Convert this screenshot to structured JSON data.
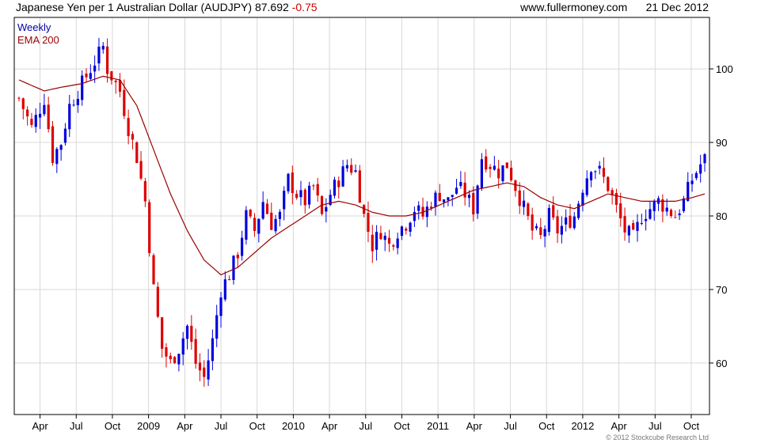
{
  "header": {
    "instrument": "Japanese Yen per 1 Australian Dollar (AUDJPY)",
    "last": "87.692",
    "change": "-0.75",
    "site": "www.fullermoney.com",
    "date": "21 Dec 2012"
  },
  "footer": {
    "copyright": "© 2012 Stockcube Research Ltd"
  },
  "colors": {
    "up": "#0000dd",
    "down": "#dd0000",
    "ema": "#990000",
    "grid": "#d8d8d8",
    "legend_weekly": "#0000aa",
    "legend_ema": "#990000"
  },
  "chart_data": {
    "type": "candlestick",
    "legend": [
      {
        "label": "Weekly"
      },
      {
        "label": "EMA 200"
      }
    ],
    "ylim": [
      53,
      107
    ],
    "y_ticks": [
      60,
      70,
      80,
      90,
      100
    ],
    "grid": true,
    "x_tick_labels": [
      "Apr",
      "Jul",
      "Oct",
      "2009",
      "Apr",
      "Jul",
      "Oct",
      "2010",
      "Apr",
      "Jul",
      "Oct",
      "2011",
      "Apr",
      "Jul",
      "Oct",
      "2012",
      "Apr",
      "Jul",
      "Oct"
    ],
    "price_anchors_weekly_close": [
      [
        0,
        96
      ],
      [
        3,
        92
      ],
      [
        6,
        96
      ],
      [
        8,
        88
      ],
      [
        10,
        90
      ],
      [
        12,
        95
      ],
      [
        15,
        98
      ],
      [
        18,
        101
      ],
      [
        20,
        103
      ],
      [
        21,
        100
      ],
      [
        24,
        97
      ],
      [
        26,
        92
      ],
      [
        28,
        88
      ],
      [
        30,
        82
      ],
      [
        32,
        70
      ],
      [
        34,
        62
      ],
      [
        36,
        60
      ],
      [
        38,
        62
      ],
      [
        40,
        65
      ],
      [
        42,
        60
      ],
      [
        44,
        58
      ],
      [
        46,
        63
      ],
      [
        48,
        70
      ],
      [
        50,
        72
      ],
      [
        52,
        75
      ],
      [
        54,
        80
      ],
      [
        56,
        78
      ],
      [
        58,
        82
      ],
      [
        60,
        79
      ],
      [
        62,
        80
      ],
      [
        64,
        85
      ],
      [
        66,
        83
      ],
      [
        68,
        82
      ],
      [
        70,
        84
      ],
      [
        72,
        80
      ],
      [
        74,
        83
      ],
      [
        76,
        85
      ],
      [
        78,
        87
      ],
      [
        80,
        86
      ],
      [
        82,
        80
      ],
      [
        84,
        76
      ],
      [
        86,
        78
      ],
      [
        88,
        76
      ],
      [
        90,
        78
      ],
      [
        92,
        79
      ],
      [
        94,
        81
      ],
      [
        96,
        80
      ],
      [
        98,
        82
      ],
      [
        100,
        83
      ],
      [
        102,
        82
      ],
      [
        104,
        84
      ],
      [
        106,
        83
      ],
      [
        108,
        81
      ],
      [
        110,
        88
      ],
      [
        112,
        87
      ],
      [
        114,
        86
      ],
      [
        116,
        87
      ],
      [
        118,
        84
      ],
      [
        120,
        81
      ],
      [
        122,
        78
      ],
      [
        124,
        77
      ],
      [
        126,
        80
      ],
      [
        128,
        78
      ],
      [
        130,
        79
      ],
      [
        132,
        80
      ],
      [
        134,
        84
      ],
      [
        136,
        87
      ],
      [
        138,
        86
      ],
      [
        140,
        84
      ],
      [
        142,
        81
      ],
      [
        144,
        78
      ],
      [
        146,
        77
      ],
      [
        148,
        80
      ],
      [
        150,
        81
      ],
      [
        152,
        82
      ],
      [
        154,
        81
      ],
      [
        156,
        80
      ],
      [
        158,
        82
      ],
      [
        160,
        85
      ],
      [
        162,
        87
      ],
      [
        163,
        87.69
      ]
    ],
    "ema200_anchors": [
      [
        0,
        98.5
      ],
      [
        6,
        97
      ],
      [
        10,
        97.5
      ],
      [
        15,
        98
      ],
      [
        20,
        99
      ],
      [
        24,
        98.5
      ],
      [
        28,
        95
      ],
      [
        32,
        89
      ],
      [
        36,
        83
      ],
      [
        40,
        78
      ],
      [
        44,
        74
      ],
      [
        48,
        72
      ],
      [
        52,
        73
      ],
      [
        56,
        75
      ],
      [
        60,
        77
      ],
      [
        64,
        78.5
      ],
      [
        68,
        80
      ],
      [
        72,
        81.5
      ],
      [
        76,
        82
      ],
      [
        80,
        81.5
      ],
      [
        84,
        80.5
      ],
      [
        88,
        80
      ],
      [
        92,
        80
      ],
      [
        96,
        80.5
      ],
      [
        100,
        81.5
      ],
      [
        104,
        82.5
      ],
      [
        108,
        83.5
      ],
      [
        112,
        84
      ],
      [
        116,
        84.5
      ],
      [
        120,
        84
      ],
      [
        124,
        82.5
      ],
      [
        128,
        81.5
      ],
      [
        132,
        81
      ],
      [
        136,
        82
      ],
      [
        140,
        83
      ],
      [
        144,
        82.5
      ],
      [
        148,
        82
      ],
      [
        152,
        82
      ],
      [
        156,
        82
      ],
      [
        160,
        82.5
      ],
      [
        163,
        83
      ]
    ]
  }
}
